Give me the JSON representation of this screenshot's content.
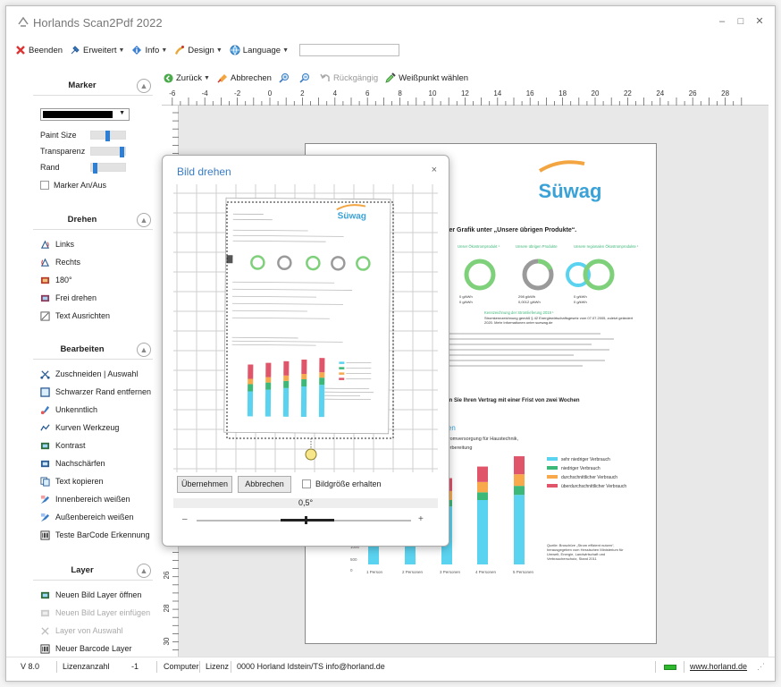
{
  "window": {
    "title": "Horlands Scan2Pdf 2022",
    "min": "–",
    "max": "□",
    "close": "✕"
  },
  "menu": [
    {
      "label": "Beenden",
      "icon": "exit-icon"
    },
    {
      "label": "Erweitert",
      "icon": "advanced-icon"
    },
    {
      "label": "Info",
      "icon": "info-icon"
    },
    {
      "label": "Design",
      "icon": "design-icon"
    },
    {
      "label": "Language",
      "icon": "language-icon"
    }
  ],
  "menu_search": {
    "value": ""
  },
  "toolbar": {
    "back": "Zurück",
    "cancel": "Abbrechen",
    "undo": "Rückgängig",
    "whitepoint": "Weißpunkt wählen"
  },
  "sidebar": {
    "marker": {
      "title": "Marker",
      "color": "#000000",
      "paint_size_label": "Paint Size",
      "paint_size": 0.45,
      "transparency_label": "Transparenz",
      "transparency": 0.9,
      "border_label": "Rand",
      "border": 0.05,
      "toggle_label": "Marker An/Aus"
    },
    "rotate": {
      "title": "Drehen",
      "items": [
        {
          "label": "Links",
          "icon": "rotate-left-icon"
        },
        {
          "label": "Rechts",
          "icon": "rotate-right-icon"
        },
        {
          "label": "180°",
          "icon": "rotate-180-icon"
        },
        {
          "label": "Frei drehen",
          "icon": "free-rotate-icon"
        },
        {
          "label": "Text Ausrichten",
          "icon": "align-text-icon"
        }
      ]
    },
    "edit": {
      "title": "Bearbeiten",
      "items": [
        {
          "label": "Zuschneiden | Auswahl",
          "icon": "crop-icon"
        },
        {
          "label": "Schwarzer Rand entfernen",
          "icon": "border-remove-icon"
        },
        {
          "label": "Unkenntlich",
          "icon": "blur-icon"
        },
        {
          "label": "Kurven Werkzeug",
          "icon": "curve-icon"
        },
        {
          "label": "Kontrast",
          "icon": "contrast-icon"
        },
        {
          "label": "Nachschärfen",
          "icon": "sharpen-icon"
        },
        {
          "label": "Text kopieren",
          "icon": "copy-text-icon"
        },
        {
          "label": "Innenbereich weißen",
          "icon": "whiten-inner-icon"
        },
        {
          "label": "Außenbereich weißen",
          "icon": "whiten-outer-icon"
        },
        {
          "label": "Teste BarCode Erkennung",
          "icon": "barcode-icon"
        }
      ]
    },
    "layer": {
      "title": "Layer",
      "items": [
        {
          "label": "Neuen Bild Layer öffnen",
          "icon": "image-layer-icon",
          "enabled": true
        },
        {
          "label": "Neuen Bild Layer einfügen",
          "icon": "insert-layer-icon",
          "enabled": false
        },
        {
          "label": "Layer von Auswahl",
          "icon": "selection-layer-icon",
          "enabled": false
        },
        {
          "label": "Neuer Barcode Layer",
          "icon": "barcode-layer-icon",
          "enabled": true
        }
      ]
    }
  },
  "ruler": {
    "h_labels": [
      "-6",
      "-4",
      "-2",
      "0",
      "2",
      "4",
      "6",
      "8",
      "10",
      "12",
      "14",
      "16",
      "18",
      "20",
      "22",
      "24",
      "26",
      "28"
    ],
    "v_labels": [
      "26",
      "28",
      "30"
    ]
  },
  "document": {
    "brand": "Süwag",
    "heading": "n der Grafik unter „Unsere übrigen Produkte“.",
    "donut_labels": [
      "Unser Ökostromprodukt ¹",
      "Unsere übrigen Produkte",
      "Unsere regionalen Ökostromprodukte ¹"
    ],
    "donut_values_a": [
      "0 g/kWh",
      "0 g/kWh"
    ],
    "donut_values_b": [
      "298 g/kWh",
      "0,0012 g/kWh"
    ],
    "donut_values_c": [
      "0 g/kWh",
      "0 g/kWh"
    ],
    "section_title": "Kennzeichnung der Stromlieferung 2019 ¹",
    "section_text": "Stromkennzeichnung gemäß § 42 Energiewirtschaftsgesetz vom 07.07.2005, zuletzt geändert 2020. Mehr Informationen unter suewag.de",
    "contract_line": "nnen Sie Ihren Vertrag mit einer Frist von zwei Wochen",
    "chart_title_a": "nden",
    "chart_title_b": "e Stromversorgung für Haustechnik,",
    "chart_title_c": "asserbereitung",
    "legend": [
      "sehr niedriger Verbrauch",
      "niedriger Verbrauch",
      "durchschnittlicher Verbrauch",
      "überdurchschnittlicher Verbrauch"
    ],
    "legend_colors": [
      "#5ad3f0",
      "#3cb878",
      "#f7a94b",
      "#e0556a"
    ],
    "categories": [
      "1 Person",
      "2 Personen",
      "3 Personen",
      "4 Personen",
      "5 Personen"
    ],
    "y_ticks": [
      "1000",
      "500",
      "0"
    ],
    "source_note": "Quelle: Broschüre „Strom effizient nutzen“, herausgegeben vom Hessischen Ministerium für Umwelt, Energie, Landwirtschaft und Verbraucherschutz, Stand 2011"
  },
  "dialog": {
    "title": "Bild drehen",
    "close": "×",
    "apply": "Übernehmen",
    "cancel": "Abbrechen",
    "keep_size": "Bildgröße erhalten",
    "angle": "0,5°",
    "minus": "–",
    "plus": "+"
  },
  "status": {
    "version": "V 8.0",
    "license_count_label": "Lizenzanzahl",
    "license_count": "-1",
    "computer": "Computer",
    "license": "Lizenz",
    "owner": "0000 Horland Idstein/TS info@horland.de",
    "link": "www.horland.de"
  }
}
